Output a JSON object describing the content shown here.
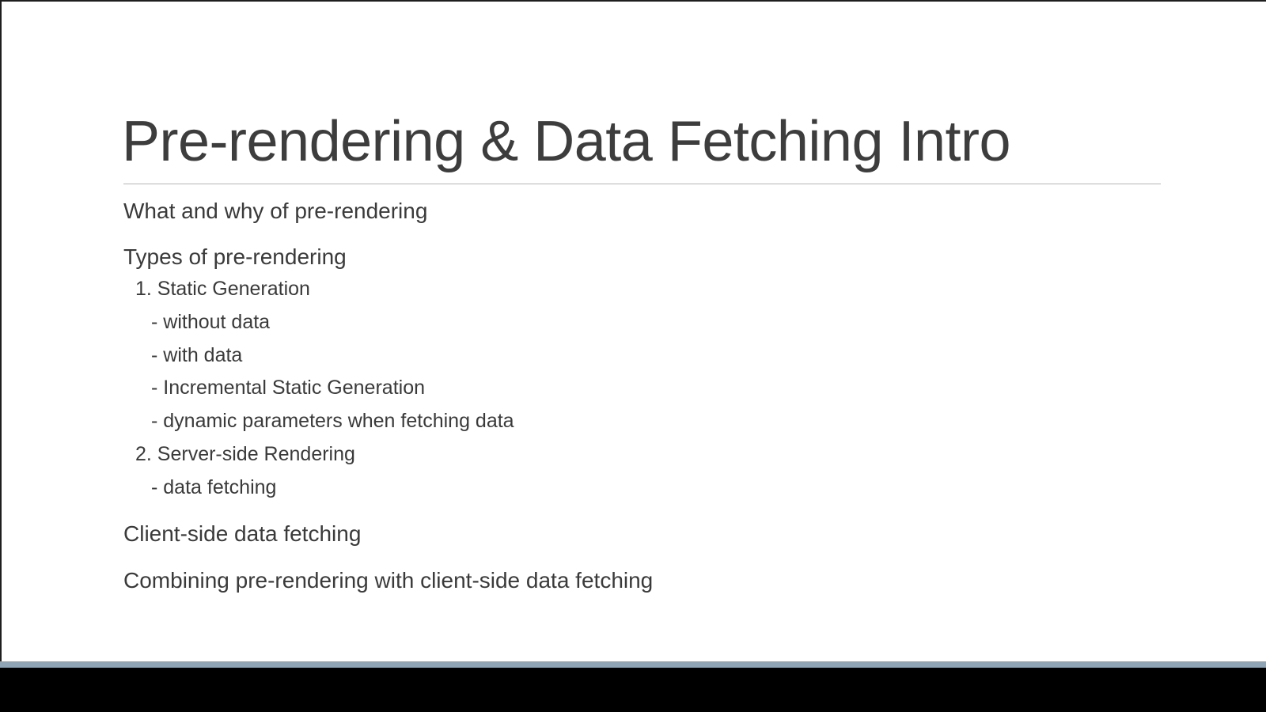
{
  "slide": {
    "title": "Pre-rendering & Data Fetching Intro",
    "topics": {
      "what_why": "What and why of pre-rendering",
      "types": "Types of pre-rendering",
      "static_generation": "1. Static Generation",
      "without_data": "- without data",
      "with_data": "- with data",
      "incremental": "- Incremental Static Generation",
      "dynamic_params": "- dynamic parameters when fetching data",
      "server_side": "2. Server-side Rendering",
      "ssr_data_fetching": "- data fetching",
      "client_side": "Client-side data fetching",
      "combining": "Combining pre-rendering with client-side data fetching"
    }
  },
  "colors": {
    "title_text": "#3d3d3d",
    "body_text": "#3a3a3a",
    "rule": "#b5b5b5",
    "footer_bar": "#8fa5b6",
    "background": "#ffffff"
  }
}
